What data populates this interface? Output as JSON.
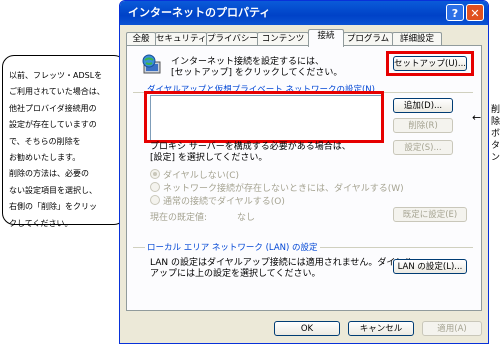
{
  "window": {
    "title": "インターネットのプロパティ",
    "help_glyph": "?",
    "close_glyph": "✕"
  },
  "tabs": [
    {
      "label": "全般"
    },
    {
      "label": "セキュリティ"
    },
    {
      "label": "プライバシー"
    },
    {
      "label": "コンテンツ"
    },
    {
      "label": "接続"
    },
    {
      "label": "プログラム"
    },
    {
      "label": "詳細設定"
    }
  ],
  "setup": {
    "text_line1": "インターネット接続を設定するには、",
    "text_line2": "[セットアップ] をクリックしてください。",
    "button": "セットアップ(U)..."
  },
  "dialup": {
    "group_label": "ダイヤルアップと仮想プライベート ネットワークの設定(N)",
    "add_button": "追加(D)...",
    "delete_button": "削除(R)",
    "settings_button": "設定(S)...",
    "proxy_text1": "プロキシ サーバーを構成する必要がある場合は、",
    "proxy_text2": "[設定] を選択してください。",
    "radio_never": "ダイヤルしない(C)",
    "radio_when_absent": "ネットワーク接続が存在しないときには、ダイヤルする(W)",
    "radio_always": "通常の接続でダイヤルする(O)",
    "default_label": "現在の既定値:",
    "default_value": "なし",
    "set_default_button": "既定に設定(E)"
  },
  "lan": {
    "group_label": "ローカル エリア ネットワーク (LAN) の設定",
    "text1": "LAN の設定はダイヤルアップ接続には適用されません。ダイヤル",
    "text2": "アップには上の設定を選択してください。",
    "button": "LAN の設定(L)..."
  },
  "footer": {
    "ok": "OK",
    "cancel": "キャンセル",
    "apply": "適用(A)"
  },
  "annotation": {
    "lines": [
      "以前、フレッツ・ADSLを",
      "ご利用されていた場合は、",
      "他社プロバイダ接続用の",
      "設定が存在していますの",
      "で、そちらの削除を",
      "お勧めいたします。",
      "削除の方法は、必要の",
      "ない設定項目を選択し、",
      "右側の「削除」をクリッ",
      "クしてください。"
    ],
    "side_arrow": "←",
    "side_label": [
      "削",
      "除",
      "ボ",
      "タ",
      "ン"
    ]
  },
  "colors": {
    "highlight": "#e60000",
    "titlebar": "#0042c7",
    "group_label": "#0046d5"
  }
}
